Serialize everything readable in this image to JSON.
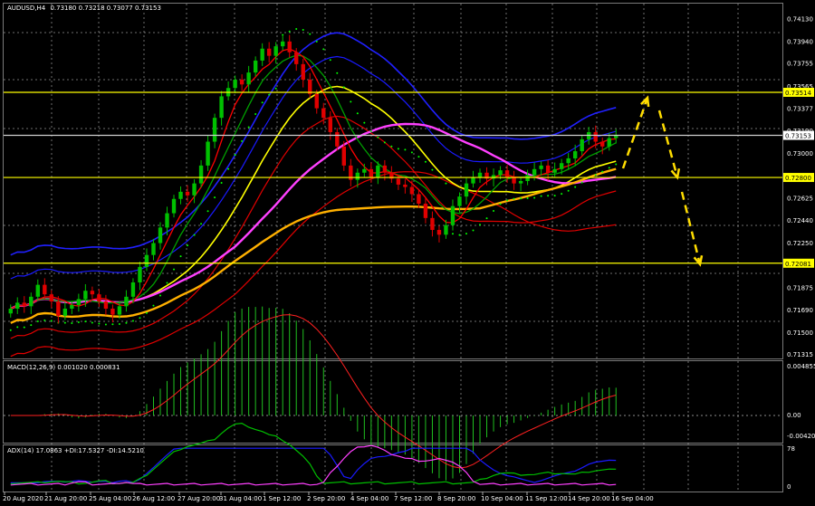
{
  "colors": {
    "background": "#000000",
    "grid": "#c8c8c8",
    "bull_candle": "#00c000",
    "bear_candle": "#e00000",
    "sma_fast": "#ff0000",
    "sma_slow": "#00a000",
    "bollinger": "#2020ff",
    "envelope": "#1a1aff",
    "ma_yellow": "#ffff00",
    "ma_magenta": "#ff40ff",
    "ma_orange": "#ffb000",
    "ma_red_low": "#e00000",
    "psar": "#00ff00",
    "hline": "#ffff00",
    "macd_hist": "#20c020",
    "macd_signal": "#ff2020",
    "adx": "#1a1aff",
    "di_plus": "#00c000",
    "di_minus": "#ff40ff",
    "forecast_arrow": "#ffdd00"
  },
  "main_panel": {
    "header": "AUDUSD,H4",
    "ohlc": "0.73180 0.73218 0.73077 0.73153",
    "price_ticks": [
      "0.74130",
      "0.73940",
      "0.73755",
      "0.73565",
      "0.73377",
      "0.73190",
      "0.73000",
      "0.72815",
      "0.72625",
      "0.72440",
      "0.72250",
      "0.72065",
      "0.71875",
      "0.71690",
      "0.71500",
      "0.71315"
    ],
    "level_labels": [
      "0.73514",
      "0.73153",
      "0.72800",
      "0.72081"
    ]
  },
  "macd_panel": {
    "header": "MACD(12,26,9) 0.001020 0.000831",
    "scale_ticks": [
      "0.004855",
      "0.00",
      "-0.004201"
    ]
  },
  "adx_panel": {
    "header": "ADX(14) 17.0863 +DI:17.5327 -DI:14.5210",
    "scale_ticks": [
      "78",
      "0"
    ]
  },
  "time_axis": [
    "20 Aug 2020",
    "21 Aug 20:00",
    "25 Aug 04:00",
    "26 Aug 12:00",
    "27 Aug 20:00",
    "31 Aug 04:00",
    "1 Sep 12:00",
    "2 Sep 20:00",
    "4 Sep 04:00",
    "7 Sep 12:00",
    "8 Sep 20:00",
    "10 Sep 04:00",
    "11 Sep 12:00",
    "14 Sep 20:00",
    "16 Sep 04:00"
  ],
  "chart_data": {
    "type": "candlestick",
    "symbol": "AUDUSD",
    "timeframe": "H4",
    "ylim": [
      0.7129,
      0.7425
    ],
    "horizontal_levels": [
      0.73514,
      0.73153,
      0.728,
      0.72081
    ],
    "closes": [
      0.717,
      0.7175,
      0.7172,
      0.718,
      0.719,
      0.7182,
      0.7176,
      0.7164,
      0.717,
      0.7173,
      0.7178,
      0.7185,
      0.7182,
      0.7176,
      0.717,
      0.7165,
      0.7172,
      0.718,
      0.7192,
      0.7205,
      0.7215,
      0.7225,
      0.7238,
      0.725,
      0.7262,
      0.7268,
      0.7265,
      0.7275,
      0.729,
      0.731,
      0.733,
      0.7348,
      0.7355,
      0.7362,
      0.7358,
      0.7368,
      0.7378,
      0.7388,
      0.7382,
      0.739,
      0.7394,
      0.7385,
      0.7375,
      0.7362,
      0.735,
      0.7338,
      0.733,
      0.7318,
      0.7306,
      0.729,
      0.7278,
      0.7284,
      0.7287,
      0.728,
      0.729,
      0.7284,
      0.7279,
      0.7274,
      0.7272,
      0.7266,
      0.7258,
      0.7246,
      0.7236,
      0.7232,
      0.724,
      0.7256,
      0.7264,
      0.7275,
      0.728,
      0.7284,
      0.7279,
      0.7282,
      0.7286,
      0.728,
      0.7275,
      0.7277,
      0.7282,
      0.7287,
      0.729,
      0.7284,
      0.7287,
      0.7292,
      0.7296,
      0.7302,
      0.7312,
      0.7318,
      0.731,
      0.7306,
      0.7313,
      0.7315
    ]
  }
}
